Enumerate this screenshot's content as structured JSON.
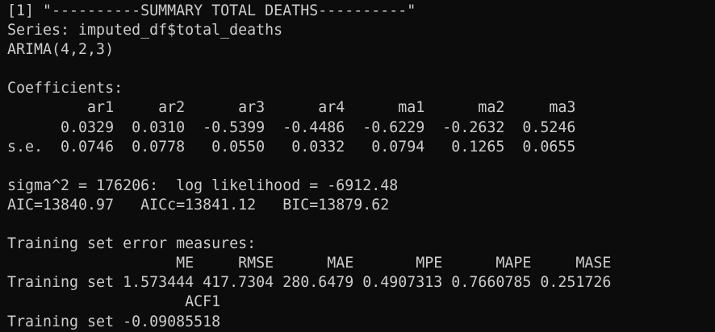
{
  "console": {
    "lines": [
      "[1] \"----------SUMMARY TOTAL DEATHS----------\"",
      "Series: imputed_df$total_deaths",
      "ARIMA(4,2,3)",
      "",
      "Coefficients:",
      "         ar1     ar2      ar3      ar4      ma1      ma2     ma3",
      "      0.0329  0.0310  -0.5399  -0.4486  -0.6229  -0.2632  0.5246",
      "s.e.  0.0746  0.0778   0.0550   0.0332   0.0794   0.1265  0.0655",
      "",
      "sigma^2 = 176206:  log likelihood = -6912.48",
      "AIC=13840.97   AICc=13841.12   BIC=13879.62",
      "",
      "Training set error measures:",
      "                   ME     RMSE      MAE       MPE      MAPE     MASE",
      "Training set 1.573444 417.7304 280.6479 0.4907313 0.7660785 0.251726",
      "                    ACF1",
      "Training set -0.09085518"
    ]
  }
}
